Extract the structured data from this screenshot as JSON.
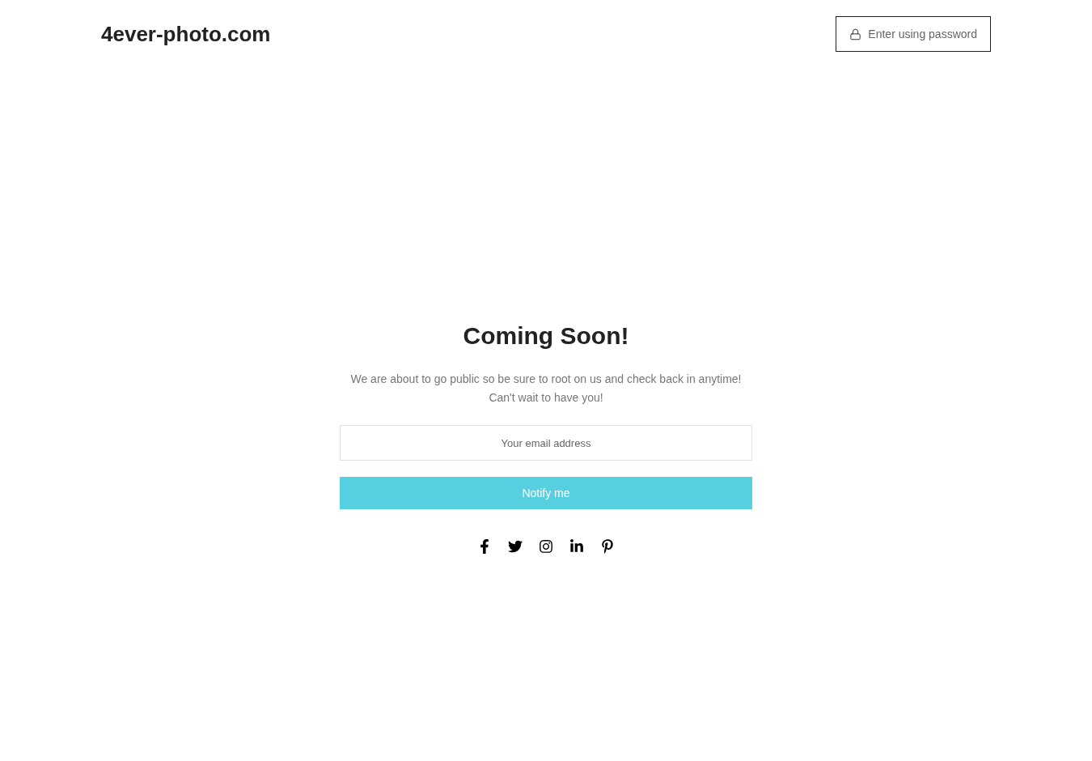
{
  "header": {
    "logo": "4ever-photo.com",
    "password_button": "Enter using password"
  },
  "main": {
    "title": "Coming Soon!",
    "description": [
      "We are about to go public so be sure to root on us and check back in anytime!",
      "Can't wait to have you!"
    ],
    "email_field": {
      "placeholder": "Your email address"
    },
    "submit_button": "Notify me",
    "social": [
      {
        "kind": "facebook"
      },
      {
        "kind": "twitter"
      },
      {
        "kind": "instagram"
      },
      {
        "kind": "linkedin"
      },
      {
        "kind": "pinterest"
      }
    ]
  }
}
